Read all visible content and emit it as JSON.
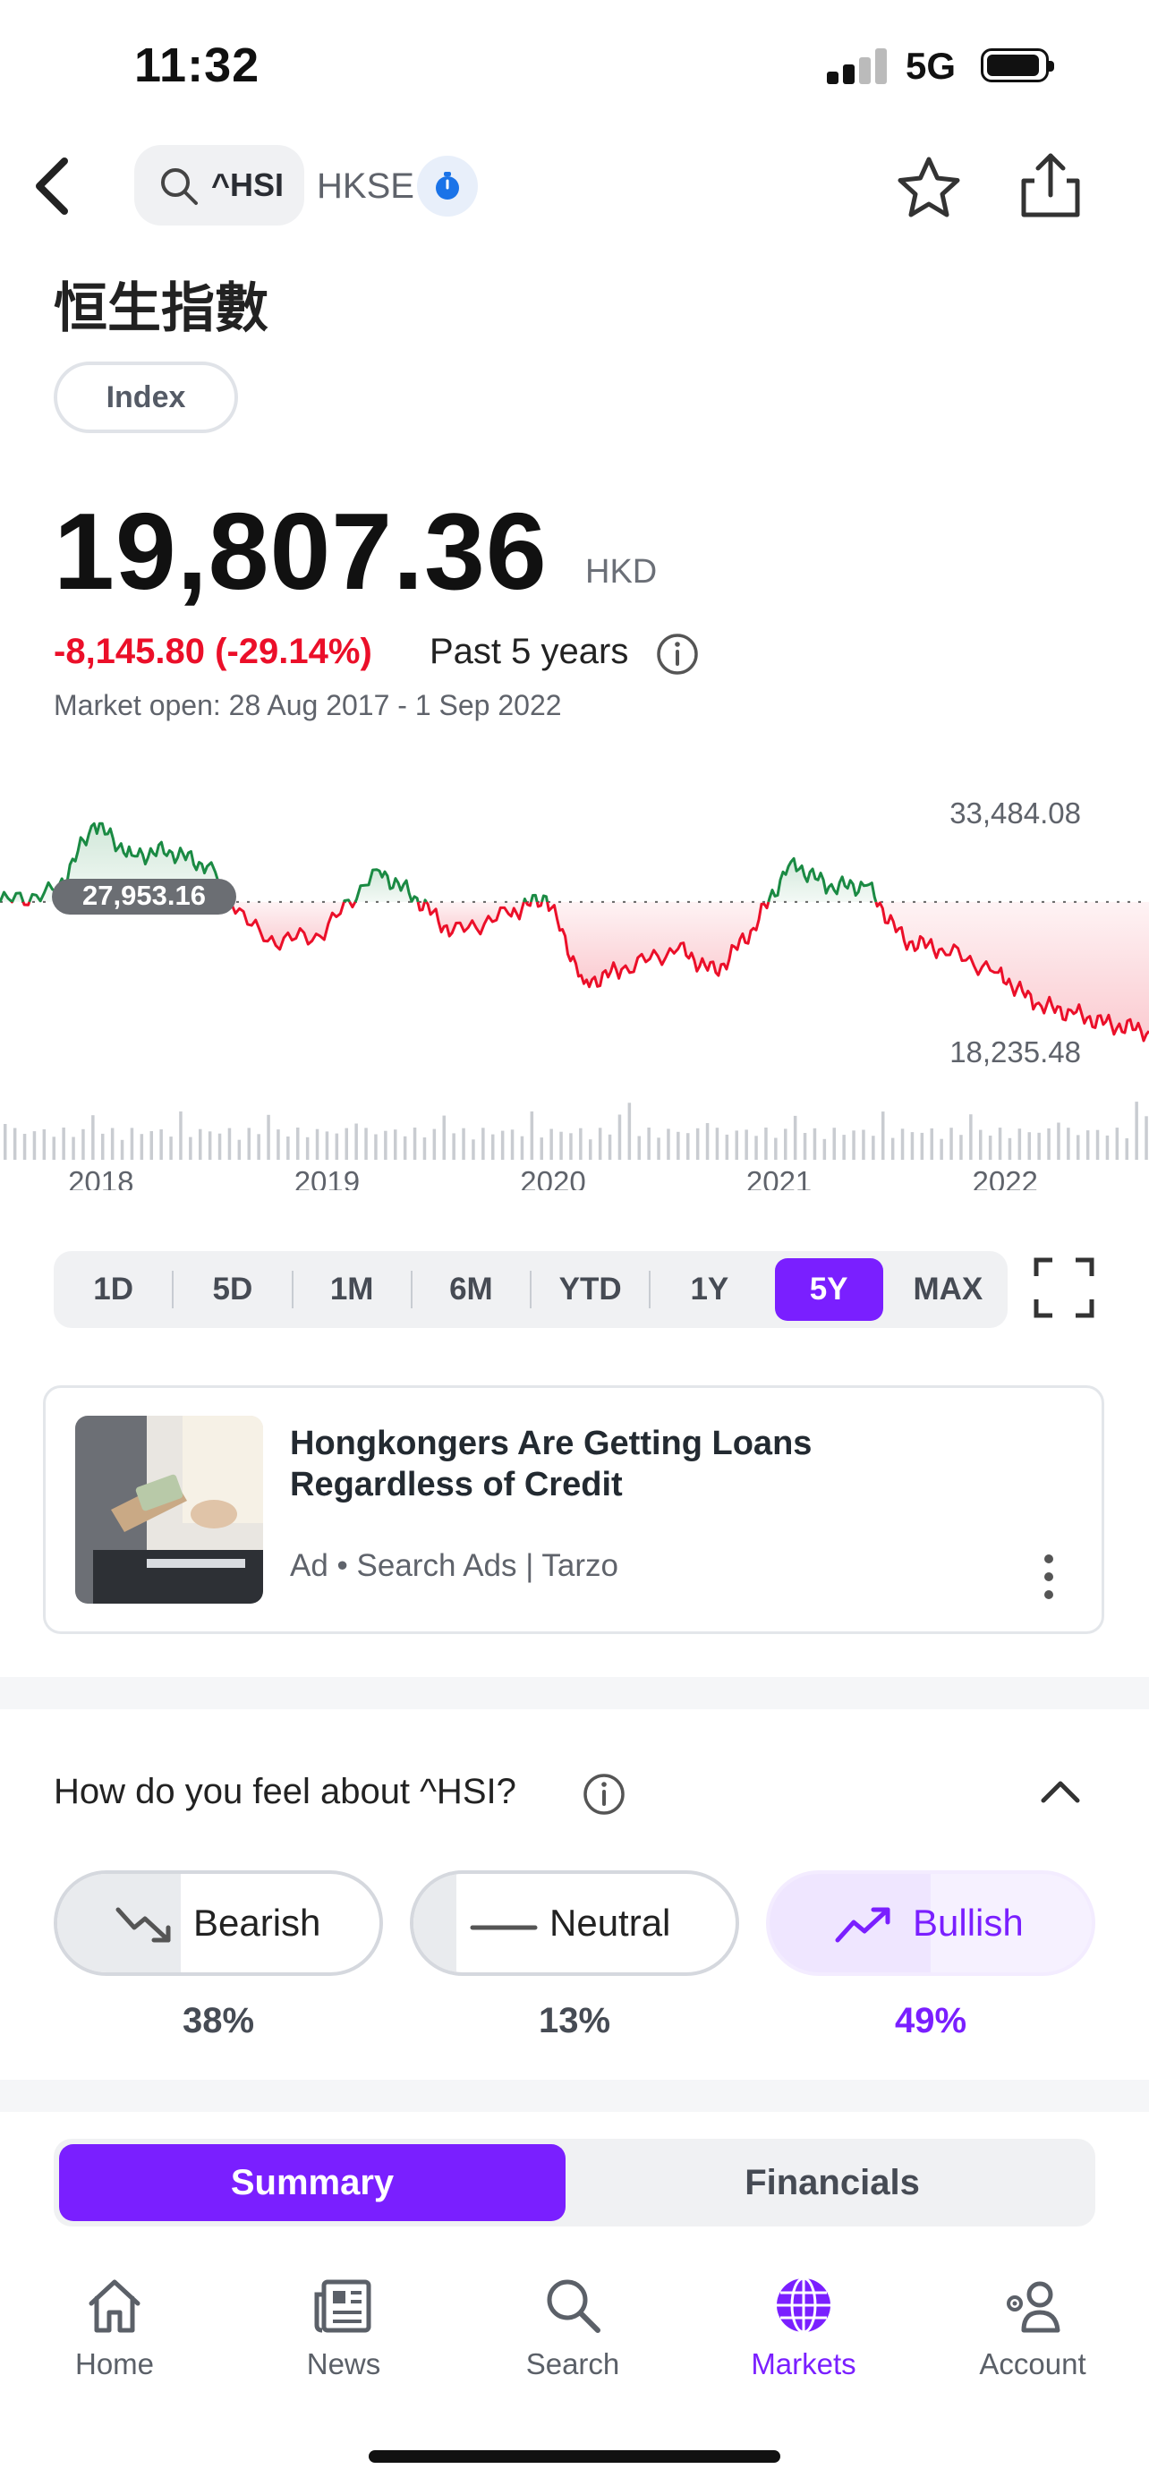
{
  "status_bar": {
    "time": "11:32",
    "network": "5G"
  },
  "header": {
    "symbol": "^HSI",
    "exchange": "HKSE"
  },
  "quote": {
    "name": "恒生指數",
    "type_tag": "Index",
    "price": "19,807.36",
    "currency": "HKD",
    "change": "-8,145.80 (-29.14%)",
    "period": "Past 5 years",
    "market_open": "Market open: 28 Aug 2017 - 1 Sep 2022"
  },
  "chart_data": {
    "type": "line",
    "baseline_label": "27,953.16",
    "high_label": "33,484.08",
    "low_label": "18,235.48",
    "x_ticks": [
      "2018",
      "2019",
      "2020",
      "2021",
      "2022"
    ],
    "x": [
      "2017-08",
      "2017-11",
      "2018-01",
      "2018-03",
      "2018-05",
      "2018-07",
      "2018-10",
      "2019-01",
      "2019-04",
      "2019-06",
      "2019-08",
      "2019-11",
      "2020-01",
      "2020-03",
      "2020-05",
      "2020-08",
      "2020-10",
      "2020-12",
      "2021-02",
      "2021-04",
      "2021-06",
      "2021-08",
      "2021-10",
      "2022-01",
      "2022-03",
      "2022-05",
      "2022-07",
      "2022-09"
    ],
    "series": [
      {
        "values": [
          27953,
          28600,
          32900,
          30900,
          31200,
          30200,
          25500,
          25800,
          30000,
          28300,
          26000,
          27200,
          28300,
          22800,
          23700,
          25000,
          23500,
          26300,
          30500,
          28900,
          29000,
          25500,
          25000,
          23500,
          21500,
          20900,
          20200,
          19807
        ]
      }
    ],
    "colors": {
      "up": "#1a8a43",
      "down": "#eb0f29"
    }
  },
  "timeframes": [
    "1D",
    "5D",
    "1M",
    "6M",
    "YTD",
    "1Y",
    "5Y",
    "MAX"
  ],
  "active_timeframe": "5Y",
  "ad": {
    "title": "Hongkongers Are Getting Loans Regardless of Credit",
    "meta": "Ad • Search Ads | Tarzo"
  },
  "sentiment": {
    "question": "How do you feel about ^HSI?",
    "bearish": {
      "label": "Bearish",
      "pct": "38%"
    },
    "neutral": {
      "label": "Neutral",
      "pct": "13%"
    },
    "bullish": {
      "label": "Bullish",
      "pct": "49%"
    }
  },
  "segments": {
    "summary": "Summary",
    "financials": "Financials"
  },
  "tabbar": {
    "home": "Home",
    "news": "News",
    "search": "Search",
    "markets": "Markets",
    "account": "Account"
  },
  "colors": {
    "accent": "#7a1fff",
    "negative": "#eb0f29",
    "positive": "#1a8a43"
  }
}
